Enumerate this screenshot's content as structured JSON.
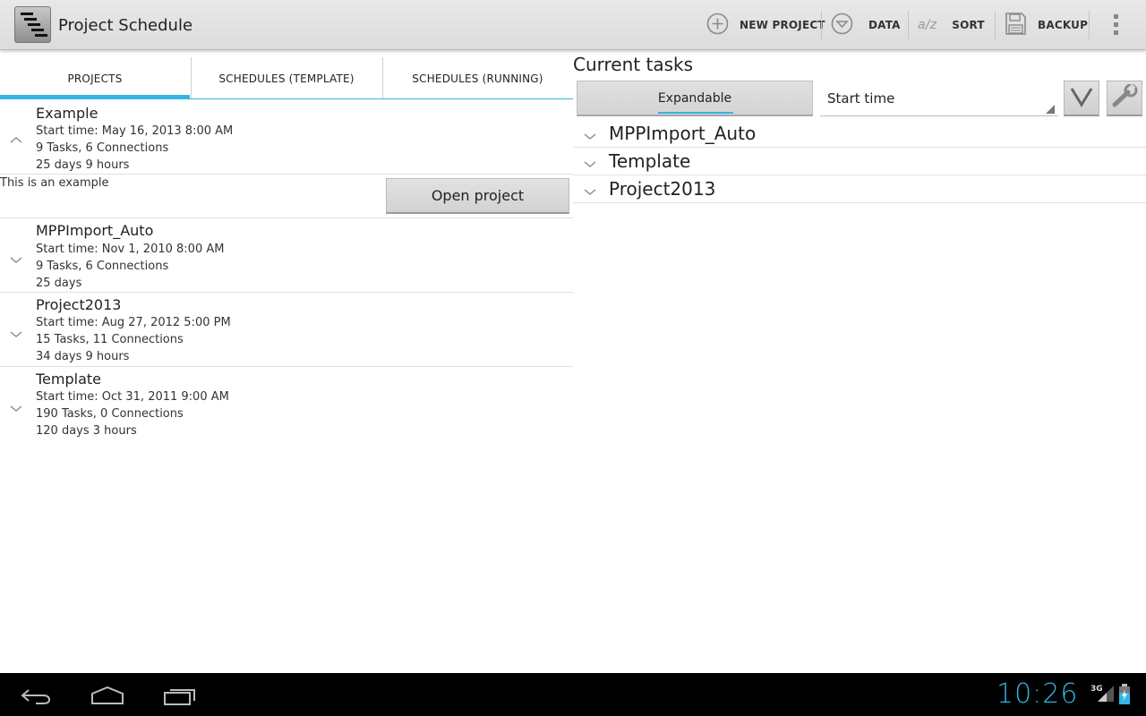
{
  "app": {
    "title": "Project Schedule"
  },
  "actions": {
    "new_project": "NEW PROJECT",
    "data": "DATA",
    "sort": "SORT",
    "backup": "BACKUP",
    "sort_icon_text": "a/z"
  },
  "tabs": [
    {
      "label": "PROJECTS",
      "active": true
    },
    {
      "label": "SCHEDULES (TEMPLATE)",
      "active": false
    },
    {
      "label": "SCHEDULES (RUNNING)",
      "active": false
    }
  ],
  "projects": [
    {
      "name": "Example",
      "start": "Start time: May 16, 2013 8:00 AM",
      "counts": "9 Tasks, 6 Connections",
      "duration": "25 days 9 hours",
      "expanded": true
    },
    {
      "name": "MPPImport_Auto",
      "start": "Start time: Nov 1, 2010 8:00 AM",
      "counts": "9 Tasks, 6 Connections",
      "duration": "25 days",
      "expanded": false
    },
    {
      "name": "Project2013",
      "start": "Start time: Aug 27, 2012 5:00 PM",
      "counts": "15 Tasks, 11 Connections",
      "duration": "34 days 9 hours",
      "expanded": false
    },
    {
      "name": "Template",
      "start": "Start time: Oct 31, 2011 9:00 AM",
      "counts": "190 Tasks, 0 Connections",
      "duration": "120 days 3 hours",
      "expanded": false
    }
  ],
  "expanded_detail": {
    "description": "This is an example",
    "open_button": "Open project"
  },
  "current_tasks": {
    "title": "Current tasks",
    "mode_button": "Expandable",
    "sort_selected": "Start time",
    "items": [
      "MPPImport_Auto",
      "Template",
      "Project2013"
    ]
  },
  "status_bar": {
    "time": "10:26",
    "network": "3G"
  },
  "colors": {
    "accent": "#33b5e5",
    "actionbar": "#dcdcdc",
    "navbar": "#000000"
  }
}
